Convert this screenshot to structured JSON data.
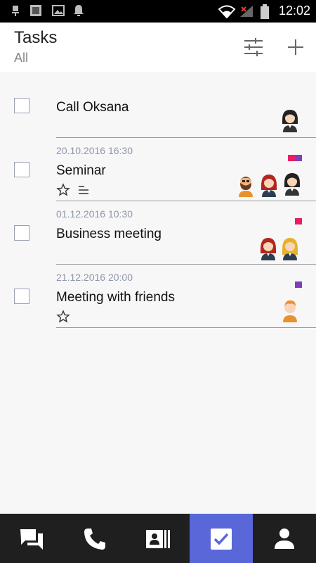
{
  "status_bar": {
    "time": "12:02",
    "icons": [
      "usb-icon",
      "image-icon",
      "gallery-icon",
      "notification-bell-icon",
      "wifi-icon",
      "no-signal-icon",
      "battery-icon"
    ]
  },
  "header": {
    "title": "Tasks",
    "subtitle": "All",
    "actions": [
      "filter-icon",
      "add-icon"
    ]
  },
  "tasks": [
    {
      "name": "Call Oksana",
      "date": "",
      "tags": [],
      "starred": false,
      "has_notes": false,
      "avatars": [
        "woman-dark-hair"
      ]
    },
    {
      "name": "Seminar",
      "date": "20.10.2016 16:30",
      "tags": [
        "#e91e63",
        "#7b3fc0"
      ],
      "starred": true,
      "has_notes": true,
      "avatars": [
        "man-beard",
        "woman-red-hair",
        "woman-dark-hair"
      ]
    },
    {
      "name": "Business meeting",
      "date": "01.12.2016 10:30",
      "tags": [
        "#e91e63"
      ],
      "starred": false,
      "has_notes": false,
      "avatars": [
        "woman-red-hair",
        "woman-blonde"
      ]
    },
    {
      "name": "Meeting with friends",
      "date": "21.12.2016 20:00",
      "tags": [
        "#7b3fc0"
      ],
      "starred": true,
      "has_notes": false,
      "avatars": [
        "man-orange"
      ]
    }
  ],
  "colors": {
    "accent": "#5a67d8",
    "tag_pink": "#e91e63",
    "tag_purple": "#7b3fc0",
    "nav_background": "#1f1f1f"
  },
  "bottom_nav": {
    "items": [
      "chat-icon",
      "phone-icon",
      "contacts-icon",
      "tasks-icon",
      "profile-icon"
    ],
    "active_item": "tasks-icon"
  }
}
